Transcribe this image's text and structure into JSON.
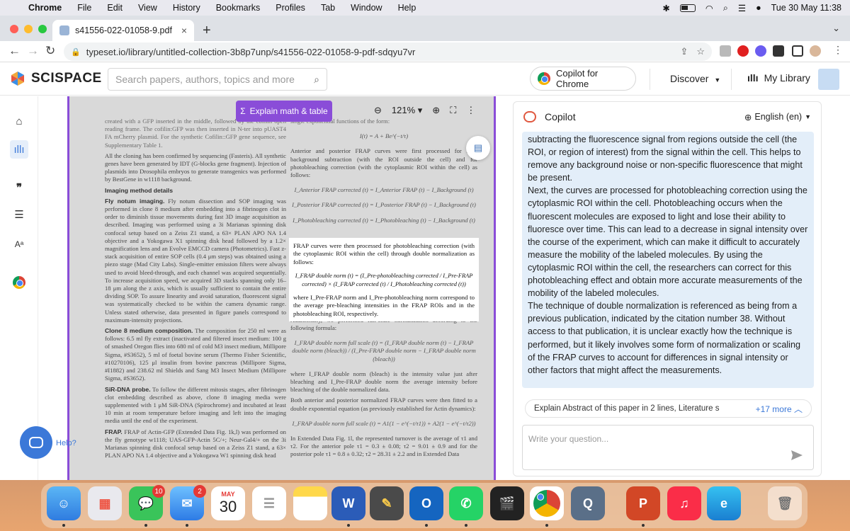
{
  "menubar": {
    "app": "Chrome",
    "items": [
      "File",
      "Edit",
      "View",
      "History",
      "Bookmarks",
      "Profiles",
      "Tab",
      "Window",
      "Help"
    ],
    "datetime": "Tue 30 May  11:38"
  },
  "browser": {
    "tab_title": "s41556-022-01058-9.pdf",
    "url": "typeset.io/library/untitled-collection-3b8p7unp/s41556-022-01058-9-pdf-sdqyu7vr"
  },
  "header": {
    "logo": "SCISPACE",
    "search_placeholder": "Search papers, authors, topics and more",
    "copilot_button": "Copilot for Chrome",
    "discover": "Discover",
    "my_library": "My Library"
  },
  "viewer": {
    "explain_button": "Explain math & table",
    "zoom": "121%",
    "left_column": {
      "top_lines": "created with a GFP inserted in the middle, followed by the cofilin open reading frame. The cofilin:GFP was then inserted in N-ter into pUAST4 FA mCherry plasmid. For the synthetic Cofilin::GFP gene sequence, see Supplementary Table 1.",
      "para1": "All the cloning has been confirmed by sequencing (Fasteris). All synthetic genes have been generated by IDT (G-blocks gene fragment). Injection of plasmids into Drosophila embryos to generate transgenics was performed by BestGene in w1118 background.",
      "heading1": "Imaging method details",
      "para2_lead": "Fly notum imaging.",
      "para2": "Fly notum dissection and SOP imaging was performed in clone 8 medium after embedding into a fibrinogen clot in order to diminish tissue movements during fast 3D image acquisition as described. Imaging was performed using a 3i Marianas spinning disk confocal setup based on a Zeiss Z1 stand, a 63× PLAN APO NA 1.4 objective and a Yokogawa X1 spinning disk head followed by a 1.2× magnification lens and an Evolve EMCCD camera (Photometrics). Fast z-stack acquisition of entire SOP cells (0.4 μm steps) was obtained using a piezo stage (Mad City Labs). Single-emitter emission filters were always used to avoid bleed-through, and each channel was acquired sequentially. To increase acquisition speed, we acquired 3D stacks spanning only 16–18 μm along the z axis, which is usually sufficient to contain the entire dividing SOP. To assure linearity and avoid saturation, fluorescent signal was systematically checked to be within the camera dynamic range. Unless stated otherwise, data presented in figure panels correspond to maximum-intensity projections.",
      "para3_lead": "Clone 8 medium composition.",
      "para3": "The composition for 250 ml were as follows: 6.5 ml fly extract (inactivated and filtered insect medium: 100 g of smashed Oregon flies into 680 ml of cold M3 insect medium, Millipore Sigma, #S3652), 5 ml of foetal bovine serum (Thermo Fisher Scientific, #10270106), 125 μl insulin from bovine pancreas (Millipore Sigma, #I1882) and 238.62 ml Shields and Sang M3 Insect Medium (Millipore Sigma, #S3652).",
      "para4_lead": "SiR-DNA probe.",
      "para4": "To follow the different mitosis stages, after fibrinogen clot embedding described as above, clone 8 imaging media were supplemented with 1 μM SiR-DNA (Spirochrome) and incubated at least 10 min at room temperature before imaging and left into the imaging media until the end of the experiment.",
      "para5_lead": "FRAP.",
      "para5": "FRAP of Actin-GFP (Extended Data Fig. 1k,l) was performed on the fly genotype w1118; UAS-GFP-Actin 5C/+; Neur-Gal4/+ on the 3i Marianas spinning disk confocal setup based on a Zeiss Z1 stand, a 63× PLAN APO NA 1.4 objective and a Yokogawa W1 spinning disk head"
    },
    "right_column": {
      "top_lines": "single exponential functions of the form:",
      "eq1": "I(t) = A + Be^(−t/τ)",
      "para1": "Anterior and posterior FRAP curves were first processed for final background subtraction (with the ROI outside the cell) and for photobleaching correction (with the cytoplasmic ROI within the cell) as follows:",
      "eq2": "I_Anterior FRAP corrected (t) = I_Anterior FRAP (t) − I_Background (t)",
      "eq3": "I_Posterior FRAP corrected (t) = I_Posterior FRAP (t) − I_Background (t)",
      "eq4": "I_Photobleaching corrected (t) = I_Photobleaching (t) − I_Background (t)",
      "para3": "Additionally, we performed full-scale normalization according to the following formula:",
      "eq5": "I_FRAP double norm full scale (t) = (I_FRAP double norm (t) − I_FRAP double norm (bleach)) / (I_Pre-FRAP double norm − I_FRAP double norm (bleach))",
      "para4": "where I_FRAP double norm (bleach) is the intensity value just after bleaching and I_Pre-FRAP double norm the average intensity before bleaching of the double normalized data.",
      "para5": "Both anterior and posterior normalized FRAP curves were then fitted to a double exponential equation (as previously established for Actin dynamics):",
      "eq6": "I_FRAP double norm full scale (t) = A1(1 − e^(−t/τ1)) + A2(1 − e^(−t/τ2))",
      "para6": "In Extended Data Fig. 1l, the represented turnover is the average of τ1 and τ2. For the anterior pole τ1 = 0.3 ± 0.08; τ2 = 9.01 ± 0.9 and for the posterior pole τ1 = 0.8 ± 0.32; τ2 = 28.31 ± 2.2 and in Extended Data"
    },
    "highlight": {
      "text1": "FRAP curves were then processed for photobleaching correction (with the cytoplasmic ROI within the cell) through double normalization as follows:",
      "eq": "I_FRAP double norm (t) = (I_Pre-photobleaching corrected / I_Pre-FRAP corrected) × (I_FRAP corrected (t) / I_Photobleaching corrected (t))",
      "text2": "where I_Pre-FRAP norm and I_Pre-photobleaching norm correspond to the average pre-bleaching intensities in the FRAP ROIs and in the photobleaching ROI, respectively."
    }
  },
  "copilot": {
    "title": "Copilot",
    "language": "English (en)",
    "answer": [
      "subtracting the fluorescence signal from regions outside the cell (the ROI, or region of interest) from the signal within the cell. This helps to remove any background noise or non-specific fluorescence that might be present.",
      "Next, the curves are processed for photobleaching correction using the cytoplasmic ROI within the cell. Photobleaching occurs when the fluorescent molecules are exposed to light and lose their ability to fluoresce over time. This can lead to a decrease in signal intensity over the course of the experiment, which can make it difficult to accurately measure the mobility of the labeled molecules. By using the cytoplasmic ROI within the cell, the researchers can correct for this photobleaching effect and obtain more accurate measurements of the mobility of the labeled molecules.",
      "The technique of double normalization is referenced as being from a previous publication, indicated by the citation number 38. Without access to that publication, it is unclear exactly how the technique is performed, but it likely involves some form of normalization or scaling of the FRAP curves to account for differences in signal intensity or other factors that might affect the measurements."
    ],
    "suggestion": "Explain Abstract of this paper in 2 lines, Literature s",
    "more": "+17 more",
    "question_placeholder": "Write your question..."
  },
  "help_label": "Help?",
  "dock": {
    "messages_badge": "10",
    "mail_badge": "2",
    "calendar_month": "MAY",
    "calendar_day": "30",
    "word_letter": "W",
    "powerpoint_letter": "P"
  },
  "colors": {
    "accent_purple": "#8a4dd8",
    "copilot_answer_bg": "#e3eef9",
    "link_blue": "#3b78d8"
  }
}
